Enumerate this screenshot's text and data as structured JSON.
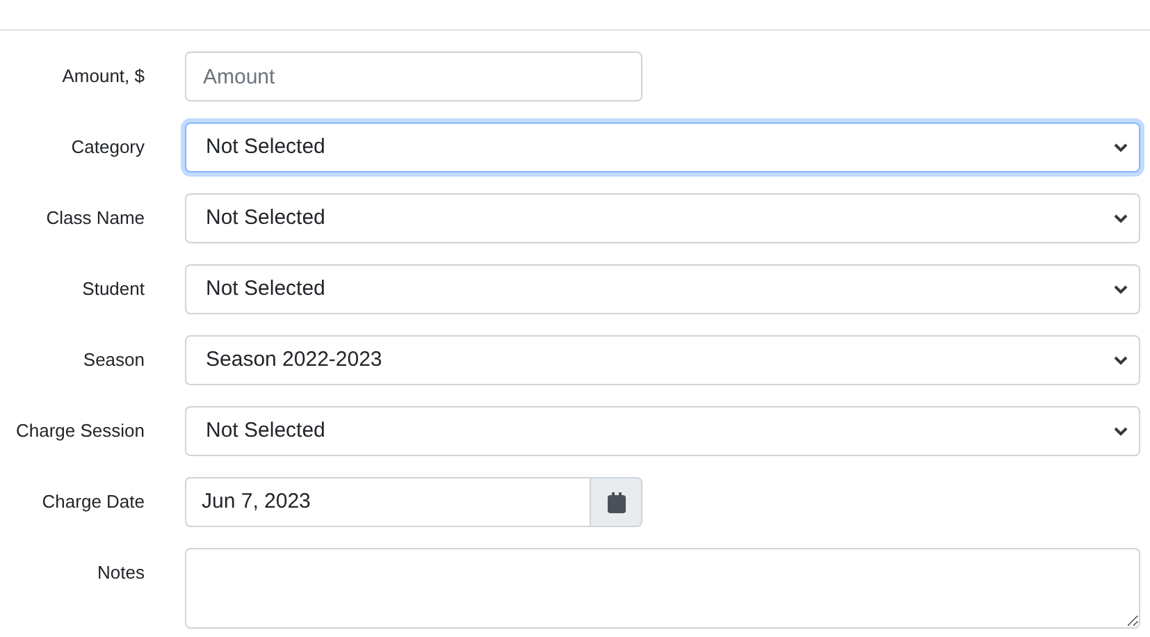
{
  "fields": [
    {
      "label": "Amount, $",
      "kind": "text",
      "placeholder": "Amount",
      "focused": false
    },
    {
      "label": "Category",
      "kind": "select",
      "value": "Not Selected",
      "focused": true
    },
    {
      "label": "Class Name",
      "kind": "select",
      "value": "Not Selected",
      "focused": false
    },
    {
      "label": "Student",
      "kind": "select",
      "value": "Not Selected",
      "focused": false
    },
    {
      "label": "Season",
      "kind": "select",
      "value": "Season 2022-2023",
      "focused": false
    },
    {
      "label": "Charge Session",
      "kind": "select",
      "value": "Not Selected",
      "focused": false
    },
    {
      "label": "Charge Date",
      "kind": "date",
      "value": "Jun 7, 2023",
      "focused": false
    },
    {
      "label": "Notes",
      "kind": "textarea",
      "focused": false
    }
  ]
}
